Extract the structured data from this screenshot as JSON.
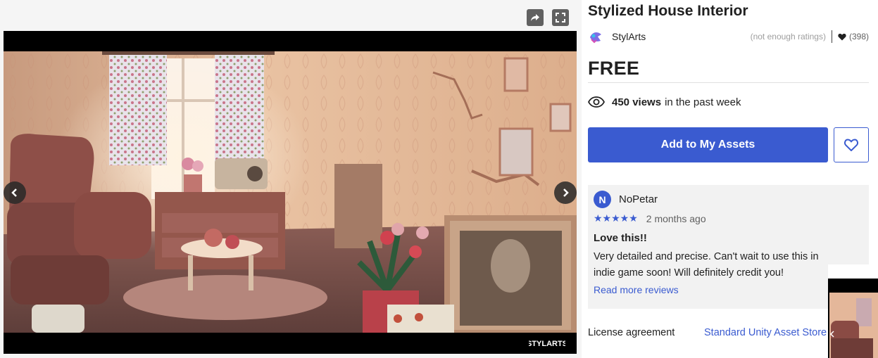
{
  "asset": {
    "title": "Stylized House Interior",
    "publisher": "StylArts",
    "ratings_text": "(not enough ratings)",
    "favorites": "(398)",
    "price": "FREE"
  },
  "views": {
    "count": "450 views",
    "suffix": "in the past week"
  },
  "actions": {
    "add_label": "Add to My Assets"
  },
  "review": {
    "avatar_initial": "N",
    "user": "NoPetar",
    "stars": "★★★★★",
    "rating": 5,
    "date": "2 months ago",
    "title": "Love this!!",
    "body": "Very detailed and precise. Can't wait to use this in indie game soon! Will definitely credit you!",
    "read_more": "Read more reviews"
  },
  "license": {
    "label": "License agreement",
    "value": "Standard Unity Asset Store EULA"
  },
  "media": {
    "watermark": "STYLARTS"
  },
  "colors": {
    "accent": "#3a5bd0",
    "review_bg": "#f2f2f2"
  }
}
